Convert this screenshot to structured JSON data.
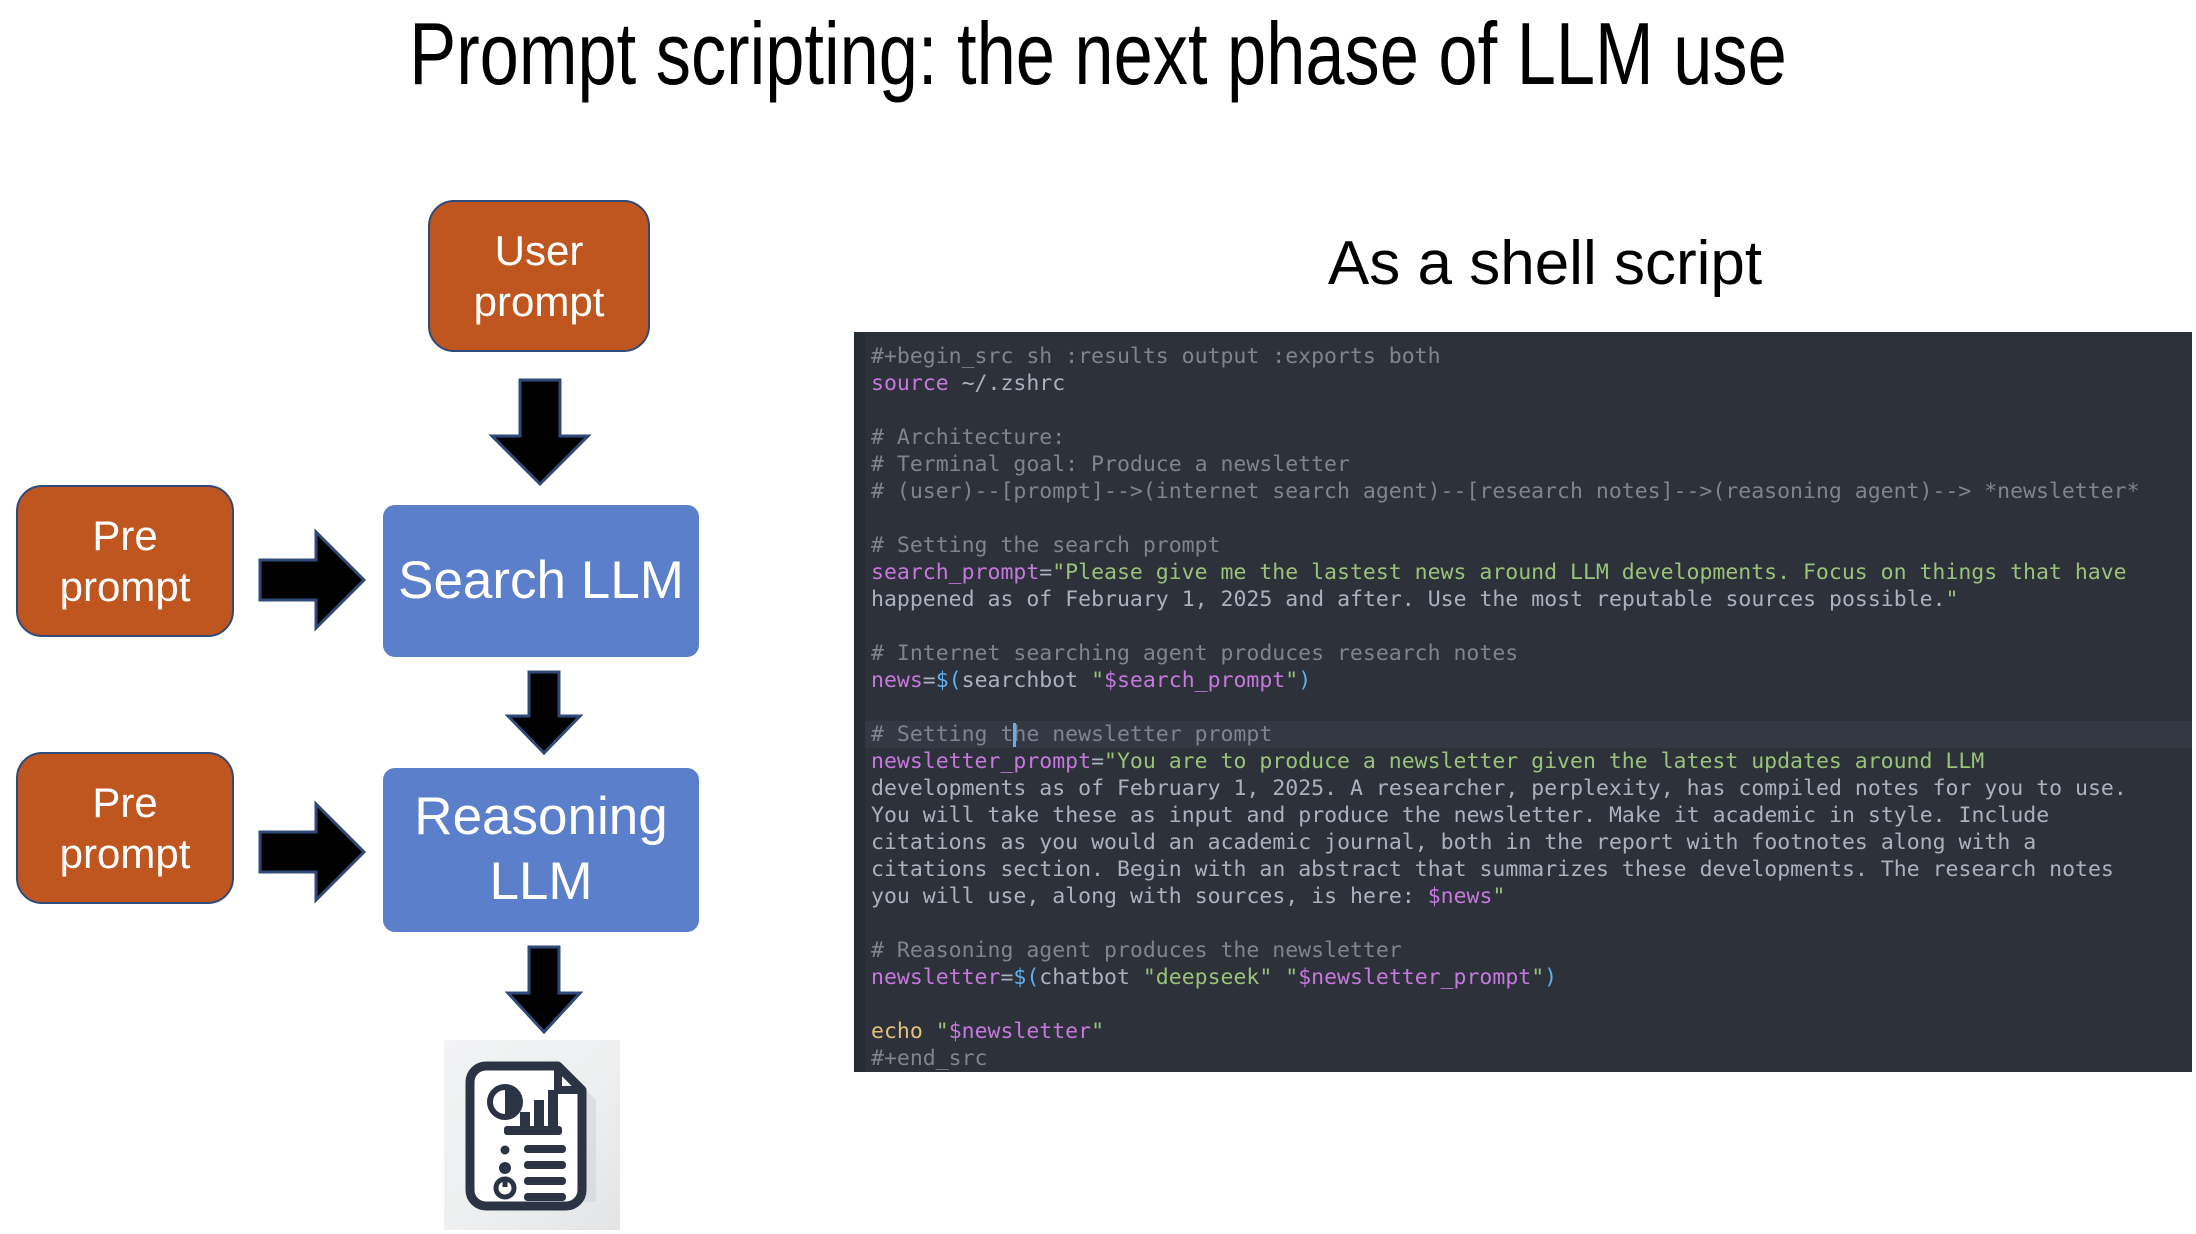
{
  "slide": {
    "title": "Prompt scripting: the next phase of LLM use"
  },
  "shell_section": {
    "heading": "As a shell script"
  },
  "diagram": {
    "nodes": [
      {
        "id": "user-prompt",
        "line1": "User",
        "line2": "prompt",
        "fill": "#C0561F",
        "border": "#2F4A78",
        "text": "#FFFFFF"
      },
      {
        "id": "pre-prompt-1",
        "line1": "Pre",
        "line2": "prompt",
        "fill": "#C0561F",
        "border": "#2F4A78",
        "text": "#FFFFFF"
      },
      {
        "id": "pre-prompt-2",
        "line1": "Pre",
        "line2": "prompt",
        "fill": "#C0561F",
        "border": "#2F4A78",
        "text": "#FFFFFF"
      },
      {
        "id": "search-llm",
        "line1": "Search LLM",
        "line2": "",
        "fill": "#5B7FCB",
        "border": "#5B7FCB",
        "text": "#FFFFFF"
      },
      {
        "id": "reasoning-llm",
        "line1": "Reasoning",
        "line2": "LLM",
        "fill": "#5B7FCB",
        "border": "#5B7FCB",
        "text": "#FFFFFF"
      }
    ],
    "arrows": [
      {
        "id": "user-to-search",
        "direction": "down",
        "color": "#000000",
        "outline": "#2F4A78"
      },
      {
        "id": "pre1-to-search",
        "direction": "right",
        "color": "#000000",
        "outline": "#2F4A78"
      },
      {
        "id": "search-to-reasoning",
        "direction": "down",
        "color": "#000000",
        "outline": "#2F4A78"
      },
      {
        "id": "pre2-to-reasoning",
        "direction": "right",
        "color": "#000000",
        "outline": "#2F4A78"
      },
      {
        "id": "reasoning-to-output",
        "direction": "down",
        "color": "#000000",
        "outline": "#2F4A78"
      }
    ],
    "output_icon": {
      "name": "report-document-icon",
      "ink": "#2B3445",
      "paper": "#FFFFFF"
    }
  },
  "code_block": {
    "background": "#282C34",
    "surface": "#2C313A",
    "current_line_background": "#333842",
    "caret_color": "#61AFEF",
    "colors": {
      "comment": "#7F848E",
      "keyword": "#C678DD",
      "variable": "#C678DD",
      "string": "#98C379",
      "builtin": "#E5C07B",
      "paren": "#61AFEF",
      "plain": "#ABB2BF"
    },
    "lines": [
      "#+begin_src sh :results output :exports both",
      "source ~/.zshrc",
      "",
      "# Architecture:",
      "# Terminal goal: Produce a newsletter",
      "# (user)--[prompt]-->(internet search agent)--[research notes]-->(reasoning agent)--> *newsletter*",
      "",
      "# Setting the search prompt",
      "search_prompt=\"Please give me the lastest news around LLM developments. Focus on things that have",
      "happened as of February 1, 2025 and after. Use the most reputable sources possible.\"",
      "",
      "# Internet searching agent produces research notes",
      "news=$(searchbot \"$search_prompt\")",
      "",
      "# Setting the newsletter prompt",
      "newsletter_prompt=\"You are to produce a newsletter given the latest updates around LLM",
      "developments as of February 1, 2025. A researcher, perplexity, has compiled notes for you to use.",
      "You will take these as input and produce the newsletter. Make it academic in style. Include",
      "citations as you would an academic journal, both in the report with footnotes along with a",
      "citations section. Begin with an abstract that summarizes these developments. The research notes",
      "you will use, along with sources, is here: $news\"",
      "",
      "# Reasoning agent produces the newsletter",
      "newsletter=$(chatbot \"deepseek\" \"$newsletter_prompt\")",
      "",
      "echo \"$newsletter\"",
      "#+end_src"
    ],
    "current_line_index": 14,
    "caret_line_text": "# Setting the newsletter prompt",
    "caret_column": 11
  }
}
